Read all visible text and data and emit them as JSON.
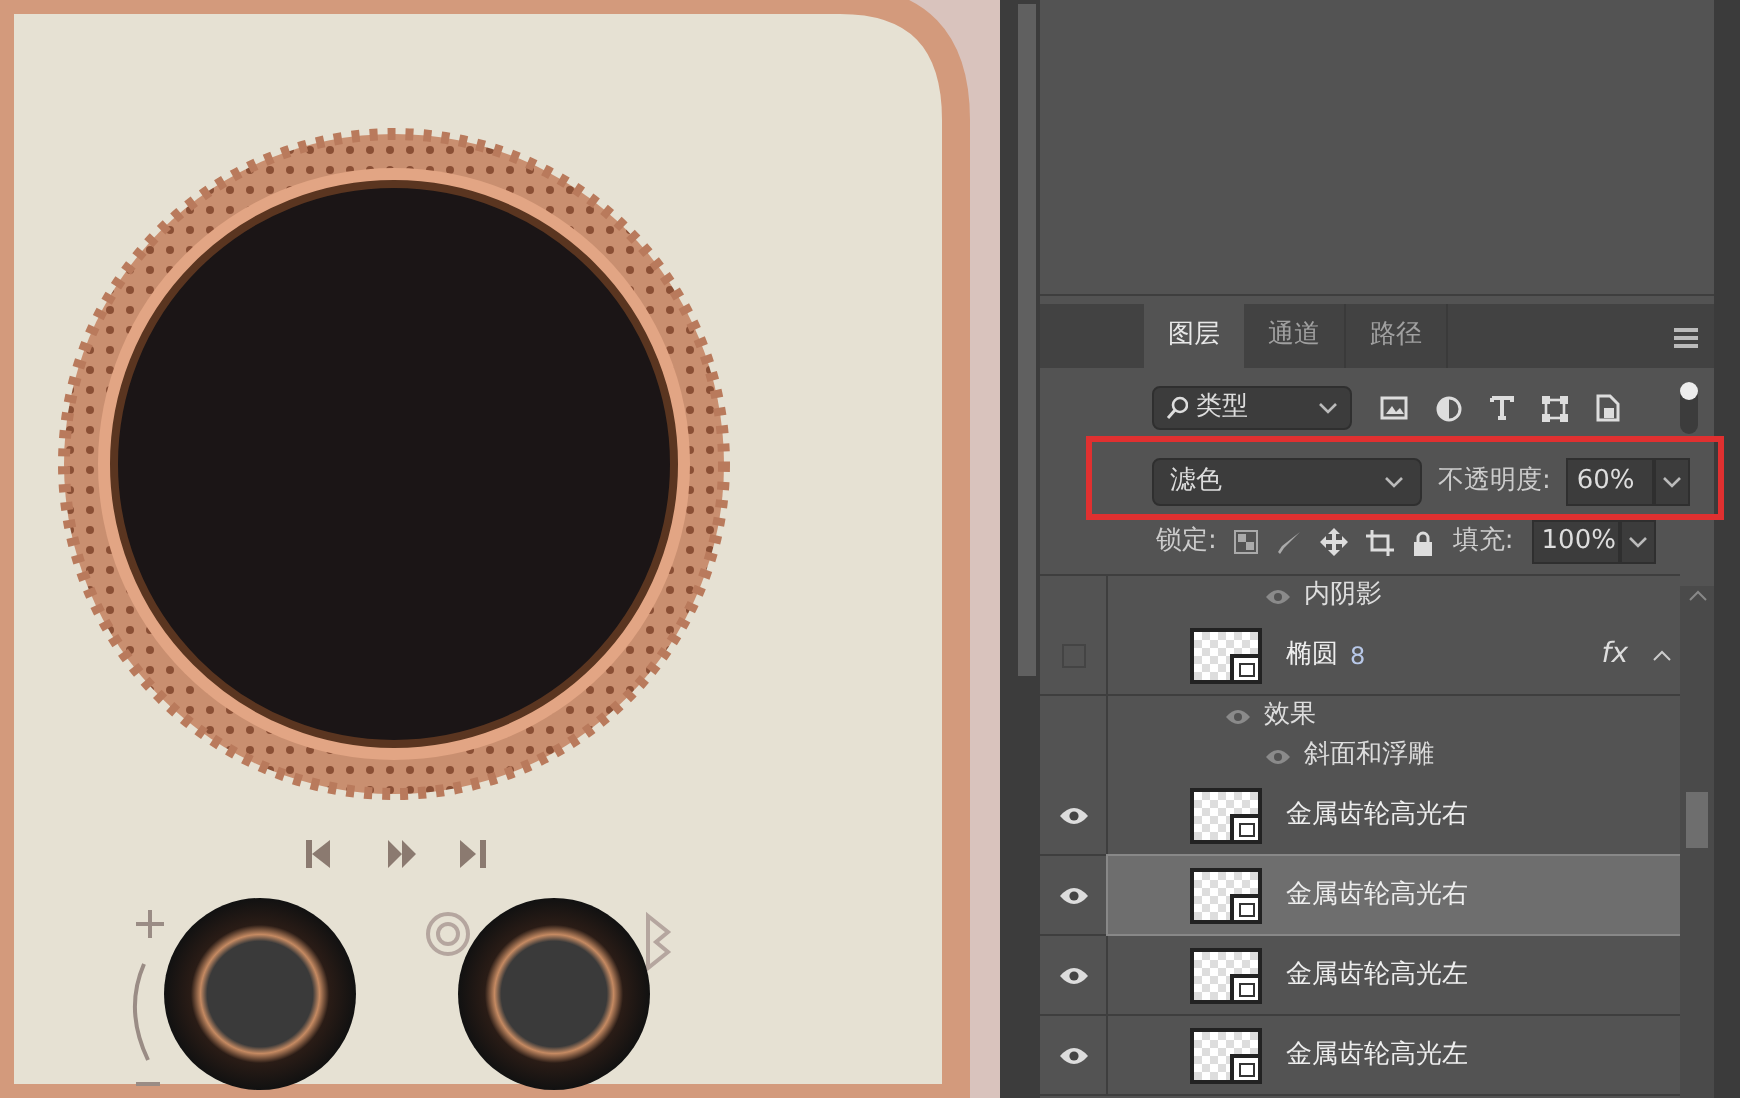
{
  "layers_panel": {
    "tabs": [
      {
        "label": "图层",
        "selected": true
      },
      {
        "label": "通道",
        "selected": false
      },
      {
        "label": "路径",
        "selected": false
      }
    ],
    "filter": {
      "value": "类型"
    },
    "blend_mode": {
      "value": "滤色"
    },
    "opacity": {
      "label": "不透明度:",
      "value": "60%"
    },
    "lock": {
      "label": "锁定:"
    },
    "fill": {
      "label": "填充:",
      "value": "100%"
    },
    "layers": [
      {
        "kind": "effect",
        "name": "内阴影",
        "visible": true
      },
      {
        "kind": "layer",
        "name": "椭圆",
        "number": "8",
        "visible": false,
        "fx": "fx",
        "expanded": true,
        "selected": false
      },
      {
        "kind": "effects",
        "name": "效果",
        "visible": true
      },
      {
        "kind": "effect",
        "name": "斜面和浮雕",
        "visible": true
      },
      {
        "kind": "layer",
        "name": "金属齿轮高光右",
        "visible": true,
        "selected": false
      },
      {
        "kind": "layer",
        "name": "金属齿轮高光右",
        "visible": true,
        "selected": true
      },
      {
        "kind": "layer",
        "name": "金属齿轮高光左",
        "visible": true,
        "selected": false
      },
      {
        "kind": "layer",
        "name": "金属齿轮高光左",
        "visible": true,
        "selected": false
      }
    ]
  }
}
